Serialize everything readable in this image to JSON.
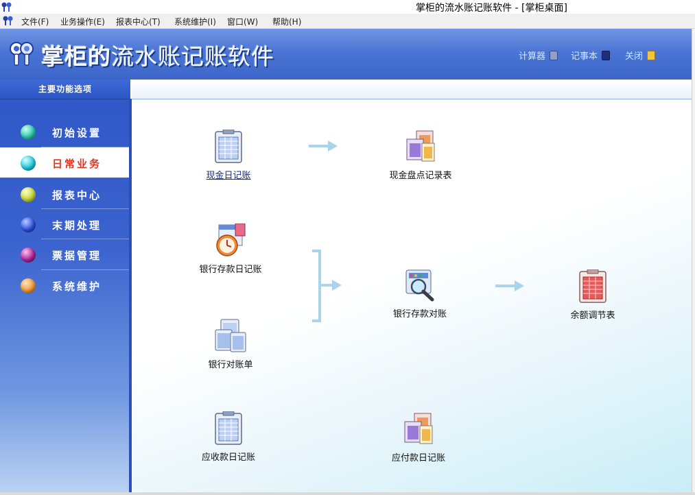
{
  "window": {
    "title": "掌柜的流水账记账软件 - [掌柜桌面]"
  },
  "menu": [
    "文件(F)",
    "业务操作(E)",
    "报表中心(T)",
    "系统维护(I)",
    "窗口(W)",
    "帮助(H)"
  ],
  "header": {
    "logo_bold": "掌柜的",
    "logo_rest": "流水账记账软件",
    "links": [
      "计算器",
      "记事本",
      "关闭"
    ]
  },
  "sidebar": {
    "heading": "主要功能选项",
    "items": [
      {
        "label": "初始设置",
        "color": "#2fc7a8"
      },
      {
        "label": "日常业务",
        "color": "#22c9d9"
      },
      {
        "label": "报表中心",
        "color": "#c9d63a"
      },
      {
        "label": "末期处理",
        "color": "#2d54e0"
      },
      {
        "label": "票据管理",
        "color": "#b0249a"
      },
      {
        "label": "系统维护",
        "color": "#f09a3a"
      }
    ],
    "active_index": 1
  },
  "features": {
    "cash_journal": "现金日记账",
    "cash_count": "现金盘点记录表",
    "bank_journal": "银行存款日记账",
    "bank_statement": "银行对账单",
    "bank_reconcile": "银行存款对账",
    "balance_adjust": "余额调节表",
    "receivable_journal": "应收款日记账",
    "payable_journal": "应付款日记账"
  }
}
